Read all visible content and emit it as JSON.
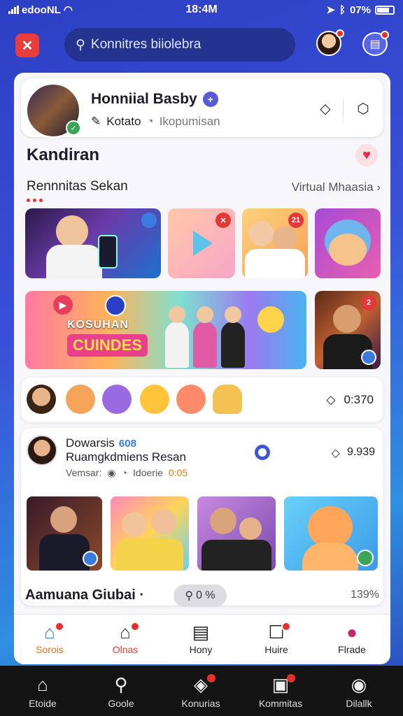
{
  "status": {
    "carrier": "edooNL",
    "time": "18:4M",
    "battery": "07%"
  },
  "search": {
    "placeholder": "Konnitres biiolebra"
  },
  "profile": {
    "name": "Honniial Basby",
    "meta1": "Kotato",
    "meta2": "Ikopumisan"
  },
  "section": {
    "title": "Kandiran",
    "subtitle": "Rennnitas Sekan",
    "link": "Virtual Mhaasia"
  },
  "banner": {
    "line1": "KOSUHAN",
    "line2": "CUINDES"
  },
  "tile_badges": [
    "2",
    "21",
    "2"
  ],
  "reactions": {
    "count": "0:370"
  },
  "post": {
    "author": "Dowarsis",
    "tag": "608",
    "subtitle": "Ruamgkdmiens Resan",
    "meta_label": "Vemsar:",
    "meta_value": "Idoerie",
    "meta_extra": "0:05",
    "count": "9.939"
  },
  "footer": {
    "title": "Aamuana Giubai",
    "pill": "0 %",
    "percent": "139%"
  },
  "tabs": [
    {
      "label": "Sorois"
    },
    {
      "label": "Olnas"
    },
    {
      "label": "Hony"
    },
    {
      "label": "Huire"
    },
    {
      "label": "Flrade"
    }
  ],
  "nav": [
    {
      "label": "Etoide"
    },
    {
      "label": "Goole"
    },
    {
      "label": "Konurias"
    },
    {
      "label": "Kommitas"
    },
    {
      "label": "Dilallk"
    }
  ],
  "colors": {
    "accent": "#e8701a",
    "brand": "#3a4fd8",
    "badge": "#e63030"
  }
}
